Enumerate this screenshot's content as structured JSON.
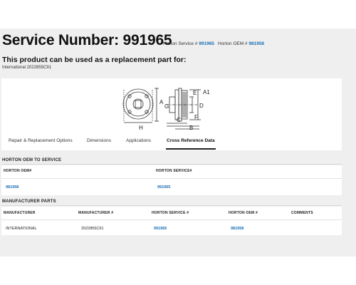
{
  "header": {
    "title": "Service Number: 991965",
    "horton_service_label": "Horton Service #",
    "horton_service_value": "991965",
    "horton_oem_label": "Horton OEM #",
    "horton_oem_value": "981958"
  },
  "replacement": {
    "title": "This product can be used as a replacement part for:",
    "part": "International 2022855C91"
  },
  "diagram": {
    "labels": {
      "a": "A",
      "g": "G",
      "h": "H",
      "c": "C",
      "b": "B",
      "e": "E",
      "a1": "A1",
      "d": "D",
      "f": "F"
    }
  },
  "tabs": [
    {
      "label": "Repair & Replacement Options",
      "active": false
    },
    {
      "label": "Dimensions",
      "active": false
    },
    {
      "label": "Applications",
      "active": false
    },
    {
      "label": "Cross Reference Data",
      "active": true
    }
  ],
  "oem_to_service": {
    "heading": "HORTON OEM TO SERVICE",
    "columns": [
      "HORTON OEM#",
      "HORTON SERVICE#"
    ],
    "rows": [
      [
        "981958",
        "991965"
      ]
    ]
  },
  "manufacturer_parts": {
    "heading": "MANUFACTURER PARTS",
    "columns": [
      "MANUFACTURER",
      "MANUFACTURER #",
      "HORTON SERVICE #",
      "HORTON OEM #",
      "COMMENTS"
    ],
    "rows": [
      [
        "INTERNATIONAL",
        "2022855C91",
        "991965",
        "981958",
        ""
      ]
    ]
  },
  "colors": {
    "link": "#1a6fb5",
    "page_bg": "#efefef"
  }
}
